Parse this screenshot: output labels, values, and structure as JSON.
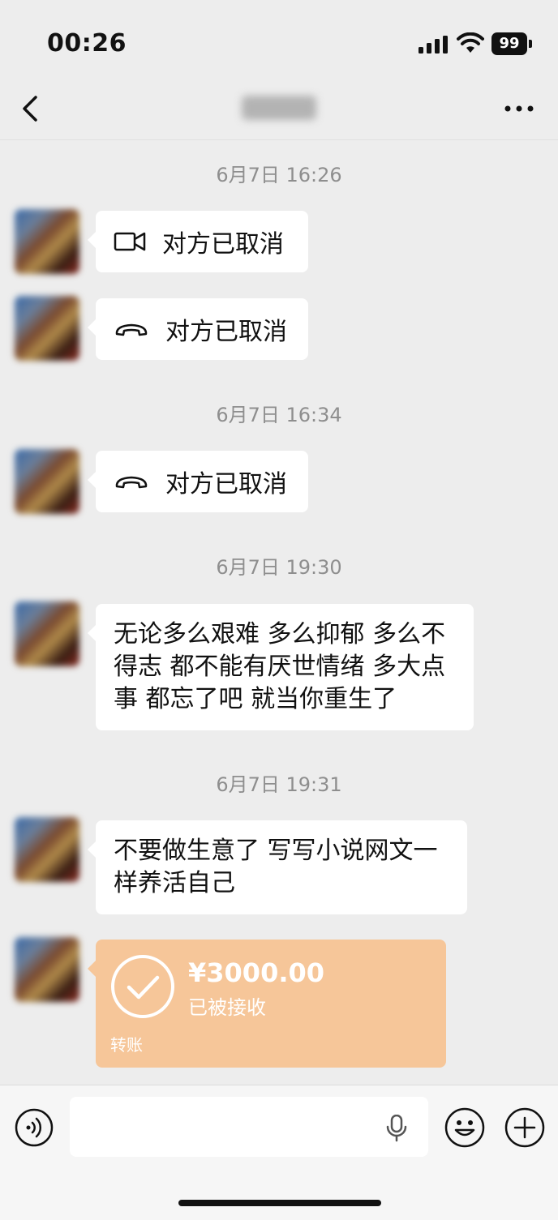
{
  "status_bar": {
    "time": "00:26",
    "battery": "99"
  },
  "nav": {
    "contact_name": ""
  },
  "messages": {
    "ts1": "6月7日 16:26",
    "call1": "对方已取消",
    "call2": "对方已取消",
    "ts2": "6月7日 16:34",
    "call3": "对方已取消",
    "ts3": "6月7日 19:30",
    "text1_lines": [
      "无论多么艰难 多么抑郁 多么不",
      "得志 都不能有厌世情绪 多大点",
      "事 都忘了吧 就当你重生了"
    ],
    "ts4": "6月7日 19:31",
    "text2_lines": [
      "不要做生意了 写写小说网文一",
      "样养活自己"
    ]
  },
  "transfer": {
    "amount": "¥3000.00",
    "status": "已被接收",
    "label": "转账"
  },
  "colors": {
    "background": "#ededed",
    "bubble": "#ffffff",
    "transfer": "#f6c699",
    "timestamp": "#8e8e8e"
  },
  "icons": [
    "video-call-icon",
    "voice-call-icon",
    "check-circle-icon",
    "voice-input-icon",
    "microphone-icon",
    "emoji-icon",
    "plus-icon",
    "back-arrow-icon",
    "more-icon"
  ]
}
